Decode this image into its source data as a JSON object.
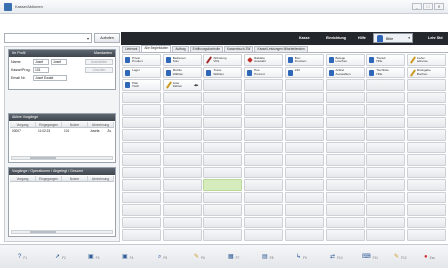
{
  "window": {
    "title": "Kasse/Aktionen",
    "minimize": "_",
    "maximize": "□",
    "close": "✕"
  },
  "toolbar": {
    "combo_value": "",
    "combo_arrow": "▾",
    "aufrufen_label": "Aufrufen"
  },
  "darkbar": {
    "items": [
      "Kasse",
      "Einrichtung",
      "Hilfe"
    ],
    "user_label": "Bitte",
    "user_arrow": "▾",
    "right_label": "Lehr Std"
  },
  "left": {
    "person_panel": {
      "title": "Ihr Profil",
      "title_right": "Mandanten",
      "name_label": "Name",
      "name_value_1": "Josef",
      "name_value_2": "Josef",
      "name_button": "Auswählen",
      "kasse_label": "Kasse/Prog.",
      "kasse_value": "101",
      "kasse_button": "Löschen",
      "email_label": "Email Nr.",
      "email_value": "Josef Ewald"
    },
    "active_panel": {
      "title": "Aktive Vorgänge",
      "columns": [
        "Vorgang",
        "Eingegangen",
        "Nutzer",
        "Abrechnung"
      ],
      "rows": [
        [
          "00007",
          "11:02:23",
          "101",
          "Josefa"
        ]
      ],
      "row_extra": "Zu."
    },
    "status_panel": {
      "title": "Vorgänge / Operationen / Abgelegt / Gesamt",
      "columns": [
        "Vorgang",
        "Eingegangen",
        "Nutzer",
        "Abrechnung"
      ]
    }
  },
  "tabs": [
    {
      "label": "Lieferant",
      "active": false
    },
    {
      "label": "Alle Begleitdaten",
      "active": true
    },
    {
      "label": "Auftrag",
      "active": false
    },
    {
      "label": "Eröffnungskontrolle",
      "active": false
    },
    {
      "label": "Kassenbuch ZW",
      "active": false
    },
    {
      "label": "Kasse/Leistungen Mitarbeitenden",
      "active": false
    }
  ],
  "grid_buttons": [
    {
      "label": "Privat\nProduct",
      "icon": "person-icon",
      "color": "#2e66b8"
    },
    {
      "label": "Bedienen\nSolo",
      "icon": "person-icon",
      "color": "#2e66b8"
    },
    {
      "label": "Abholung\nVRL",
      "icon": "pen-icon",
      "color": "#a02a2a"
    },
    {
      "label": "Rabatte\nAuswahl",
      "icon": "diamond-icon",
      "color": "#c0302a"
    },
    {
      "label": "Bon\nDrucken",
      "icon": "person-icon",
      "color": "#2e66b8"
    },
    {
      "label": "Belege\nLöschen",
      "icon": "person-icon",
      "color": "#2e66b8"
    },
    {
      "label": "Transit\nHilfe",
      "icon": "person-icon",
      "color": "#2e66b8"
    },
    {
      "label": "Liefer-\nadresse",
      "icon": "pen-icon",
      "color": "#c89a20"
    },
    {
      "label": "Lager",
      "icon": "person-icon",
      "color": "#2e66b8"
    },
    {
      "label": "Mobile\nWählen",
      "icon": "person-icon",
      "color": "#2e66b8"
    },
    {
      "label": "Trans.\nWählen",
      "icon": "person-icon",
      "color": "#2e66b8"
    },
    {
      "label": "Pos.\nProzent",
      "icon": "person-icon",
      "color": "#2e66b8"
    },
    {
      "label": "246",
      "icon": "person-icon",
      "color": "#2e66b8"
    },
    {
      "label": "Artikel\nAuswahlen",
      "icon": "person-icon",
      "color": "#2e66b8"
    },
    {
      "label": "Tischliste\nHilfe",
      "icon": "person-icon",
      "color": "#2e66b8"
    },
    {
      "label": "Rückgabe\nBuchen",
      "icon": "pen-icon",
      "color": "#c89a20"
    },
    {
      "label": "Plan\nTisch",
      "icon": "person-icon",
      "color": "#2e66b8"
    },
    {
      "label": "Liste\nZahlen",
      "icon": "pen-icon",
      "color": "#c89a20",
      "extra": "◀▶"
    }
  ],
  "bottom_buttons": [
    {
      "icon": "question-icon",
      "glyph": "?",
      "label": "F1"
    },
    {
      "icon": "cursor-icon",
      "glyph": "➚",
      "label": "F2"
    },
    {
      "icon": "floppy-icon",
      "glyph": "▣",
      "label": "F3"
    },
    {
      "icon": "floppy-icon",
      "glyph": "▣",
      "label": "F4"
    },
    {
      "icon": "search-icon",
      "glyph": "⌕",
      "label": "F5"
    },
    {
      "icon": "pen-icon",
      "glyph": "✎",
      "label": "F6"
    },
    {
      "icon": "grid-icon",
      "glyph": "▦",
      "label": "F7"
    },
    {
      "icon": "document-icon",
      "glyph": "▤",
      "label": "F8"
    },
    {
      "icon": "arrow-corner-icon",
      "glyph": "↳",
      "label": "F9"
    },
    {
      "icon": "swap-icon",
      "glyph": "⇄",
      "label": "F10"
    },
    {
      "icon": "keyboard-icon",
      "glyph": "⌨",
      "label": "F11"
    },
    {
      "icon": "pen-icon",
      "glyph": "✎",
      "label": "F12"
    },
    {
      "icon": "exit-icon",
      "glyph": "●",
      "label": "Esc"
    }
  ]
}
